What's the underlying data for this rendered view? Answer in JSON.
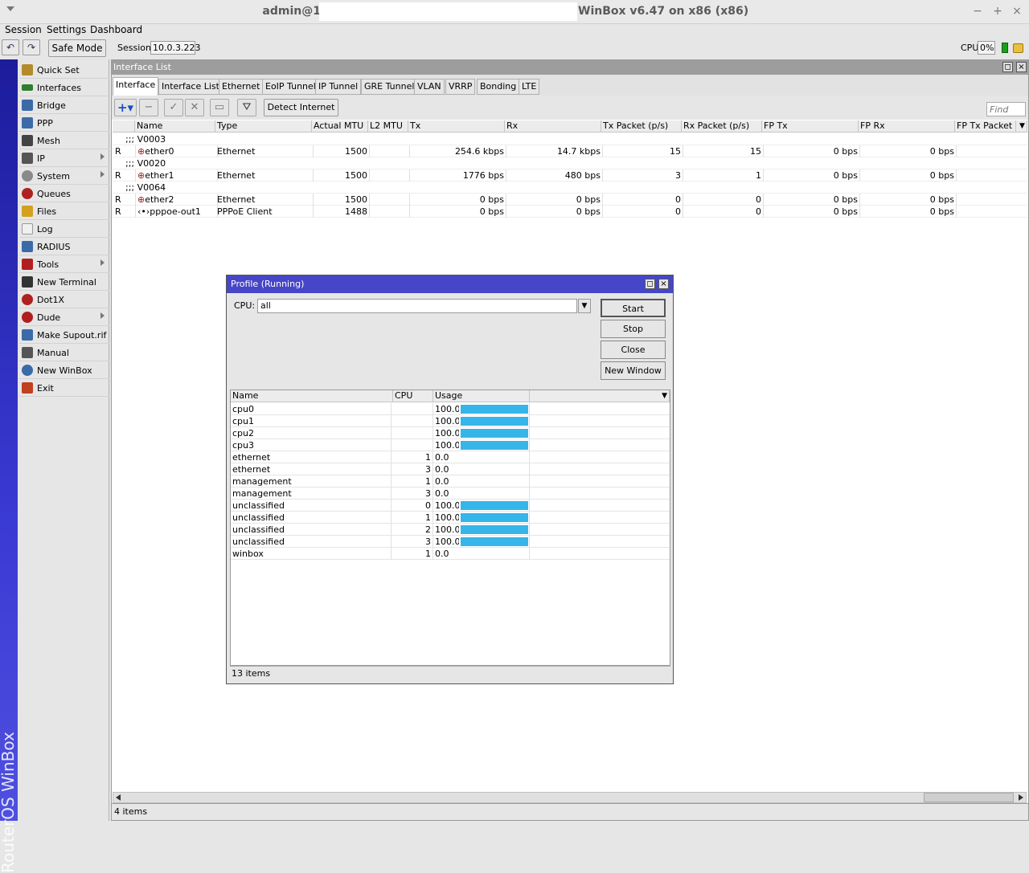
{
  "window": {
    "title_prefix": "admin@1",
    "title_suffix": "WinBox v6.47 on x86 (x86)"
  },
  "menu": [
    "Session",
    "Settings",
    "Dashboard"
  ],
  "toolbar": {
    "safe_mode": "Safe Mode",
    "session_label": "Session:",
    "session_value": "10.0.3.223",
    "cpu_label": "CPU:",
    "cpu_value": "0%"
  },
  "brand": "RouterOS WinBox",
  "sidebar": {
    "items": [
      {
        "label": "Quick Set",
        "icon": "wand-icon",
        "color": "#b38b2a",
        "sub": false
      },
      {
        "label": "Interfaces",
        "icon": "interfaces-icon",
        "color": "#2f7d2f",
        "sub": false
      },
      {
        "label": "Bridge",
        "icon": "bridge-icon",
        "color": "#3a6aa8",
        "sub": false
      },
      {
        "label": "PPP",
        "icon": "ppp-icon",
        "color": "#3a6aa8",
        "sub": false
      },
      {
        "label": "Mesh",
        "icon": "mesh-icon",
        "color": "#444",
        "sub": false
      },
      {
        "label": "IP",
        "icon": "ip-icon",
        "color": "#555",
        "sub": true
      },
      {
        "label": "System",
        "icon": "system-icon",
        "color": "#8a8a8a",
        "sub": true
      },
      {
        "label": "Queues",
        "icon": "queues-icon",
        "color": "#b02020",
        "sub": false
      },
      {
        "label": "Files",
        "icon": "files-icon",
        "color": "#d4a020",
        "sub": false
      },
      {
        "label": "Log",
        "icon": "log-icon",
        "color": "#f0f0f0",
        "sub": false
      },
      {
        "label": "RADIUS",
        "icon": "radius-icon",
        "color": "#3a6aa8",
        "sub": false
      },
      {
        "label": "Tools",
        "icon": "tools-icon",
        "color": "#b02020",
        "sub": true
      },
      {
        "label": "New Terminal",
        "icon": "terminal-icon",
        "color": "#333",
        "sub": false
      },
      {
        "label": "Dot1X",
        "icon": "dot1x-icon",
        "color": "#b02020",
        "sub": false
      },
      {
        "label": "Dude",
        "icon": "dude-icon",
        "color": "#b02020",
        "sub": true
      },
      {
        "label": "Make Supout.rif",
        "icon": "supout-icon",
        "color": "#3a6aa8",
        "sub": false
      },
      {
        "label": "Manual",
        "icon": "manual-icon",
        "color": "#555",
        "sub": false
      },
      {
        "label": "New WinBox",
        "icon": "winbox-icon",
        "color": "#3a6aa8",
        "sub": false
      },
      {
        "label": "Exit",
        "icon": "exit-icon",
        "color": "#c04020",
        "sub": false
      }
    ]
  },
  "interface_list": {
    "title": "Interface List",
    "tabs": [
      "Interface",
      "Interface List",
      "Ethernet",
      "EoIP Tunnel",
      "IP Tunnel",
      "GRE Tunnel",
      "VLAN",
      "VRRP",
      "Bonding",
      "LTE"
    ],
    "detect_internet": "Detect Internet",
    "find_placeholder": "Find",
    "columns": [
      "Name",
      "Type",
      "Actual MTU",
      "L2 MTU",
      "Tx",
      "Rx",
      "Tx Packet (p/s)",
      "Rx Packet (p/s)",
      "FP Tx",
      "FP Rx",
      "FP Tx Packet (p"
    ],
    "rows": [
      {
        "comment": ";;; V0003"
      },
      {
        "flag": "R",
        "name": "ether0",
        "type": "Ethernet",
        "mtu": "1500",
        "l2mtu": "",
        "tx": "254.6 kbps",
        "rx": "14.7 kbps",
        "txp": "15",
        "rxp": "15",
        "fptx": "0 bps",
        "fprx": "0 bps"
      },
      {
        "comment": ";;; V0020"
      },
      {
        "flag": "R",
        "name": "ether1",
        "type": "Ethernet",
        "mtu": "1500",
        "l2mtu": "",
        "tx": "1776 bps",
        "rx": "480 bps",
        "txp": "3",
        "rxp": "1",
        "fptx": "0 bps",
        "fprx": "0 bps"
      },
      {
        "comment": ";;; V0064"
      },
      {
        "flag": "R",
        "name": "ether2",
        "type": "Ethernet",
        "mtu": "1500",
        "l2mtu": "",
        "tx": "0 bps",
        "rx": "0 bps",
        "txp": "0",
        "rxp": "0",
        "fptx": "0 bps",
        "fprx": "0 bps"
      },
      {
        "flag": "R",
        "name": "pppoe-out1",
        "type": "PPPoE Client",
        "mtu": "1488",
        "l2mtu": "",
        "tx": "0 bps",
        "rx": "0 bps",
        "txp": "0",
        "rxp": "0",
        "fptx": "0 bps",
        "fprx": "0 bps"
      }
    ],
    "status": "4 items"
  },
  "profile": {
    "title": "Profile (Running)",
    "cpu_label": "CPU:",
    "cpu_value": "all",
    "buttons": [
      "Start",
      "Stop",
      "Close",
      "New Window"
    ],
    "columns": [
      "Name",
      "CPU",
      "Usage"
    ],
    "rows": [
      {
        "name": "cpu0",
        "cpu": "",
        "usage": "100.0",
        "level": 100
      },
      {
        "name": "cpu1",
        "cpu": "",
        "usage": "100.0",
        "level": 100
      },
      {
        "name": "cpu2",
        "cpu": "",
        "usage": "100.0",
        "level": 100
      },
      {
        "name": "cpu3",
        "cpu": "",
        "usage": "100.0",
        "level": 100
      },
      {
        "name": "ethernet",
        "cpu": "1",
        "usage": "0.0",
        "level": 0
      },
      {
        "name": "ethernet",
        "cpu": "3",
        "usage": "0.0",
        "level": 0
      },
      {
        "name": "management",
        "cpu": "1",
        "usage": "0.0",
        "level": 0
      },
      {
        "name": "management",
        "cpu": "3",
        "usage": "0.0",
        "level": 0
      },
      {
        "name": "unclassified",
        "cpu": "0",
        "usage": "100.0",
        "level": 100
      },
      {
        "name": "unclassified",
        "cpu": "1",
        "usage": "100.0",
        "level": 100
      },
      {
        "name": "unclassified",
        "cpu": "2",
        "usage": "100.0",
        "level": 100
      },
      {
        "name": "unclassified",
        "cpu": "3",
        "usage": "100.0",
        "level": 100
      },
      {
        "name": "winbox",
        "cpu": "1",
        "usage": "0.0",
        "level": 0
      }
    ],
    "status": "13 items",
    "bar_color": "#35b5e9"
  }
}
